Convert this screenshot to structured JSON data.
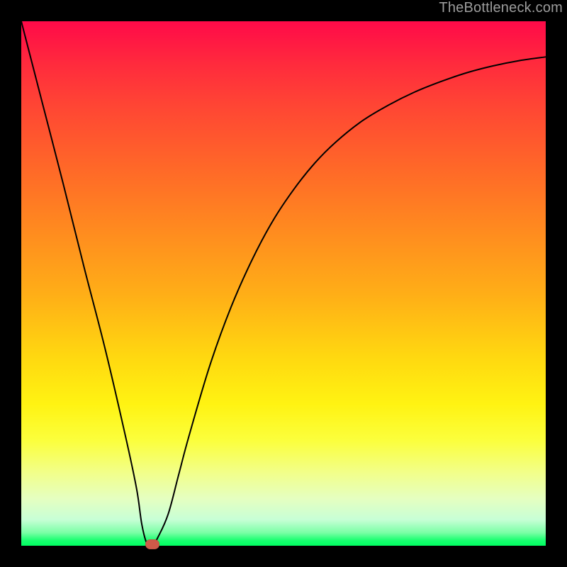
{
  "watermark": "TheBottleneck.com",
  "colors": {
    "frame_bg": "#000000",
    "curve_stroke": "#000000",
    "dot_fill": "#cf5a49",
    "gradient_top": "#ff0a49",
    "gradient_bottom": "#00ff62"
  },
  "chart_data": {
    "type": "line",
    "title": "",
    "xlabel": "",
    "ylabel": "",
    "xlim": [
      0,
      100
    ],
    "ylim": [
      0,
      100
    ],
    "x": [
      0,
      4,
      8,
      12,
      16,
      20,
      22,
      23,
      24,
      25,
      26,
      28,
      30,
      32,
      36,
      40,
      44,
      48,
      52,
      56,
      60,
      65,
      70,
      75,
      80,
      85,
      90,
      95,
      100
    ],
    "values": [
      100,
      84.5,
      69,
      53,
      37.5,
      20.3,
      10.8,
      4.0,
      0.3,
      0.0,
      1.5,
      6.0,
      13.5,
      21.0,
      34.5,
      45.5,
      54.5,
      62.0,
      68.0,
      73.0,
      77.0,
      81.0,
      84.0,
      86.5,
      88.5,
      90.2,
      91.5,
      92.5,
      93.2
    ],
    "marker": {
      "x": 25,
      "y": 0
    },
    "legend": false,
    "grid": false,
    "axes_visible": false
  }
}
